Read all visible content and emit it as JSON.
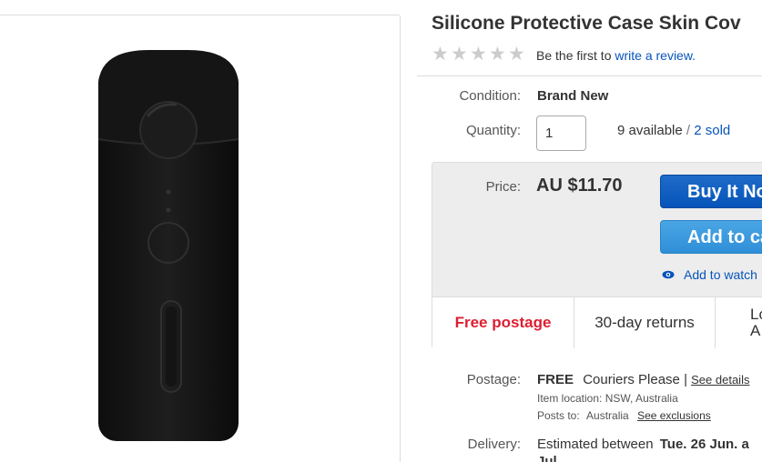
{
  "product": {
    "title": "Silicone Protective Case Skin Cov",
    "review_prefix": "Be the first to",
    "review_link": "write a review."
  },
  "condition": {
    "label": "Condition:",
    "value": "Brand New"
  },
  "quantity": {
    "label": "Quantity:",
    "value": "1",
    "available": "9 available",
    "separator": "/",
    "sold": "2 sold"
  },
  "price": {
    "label": "Price:",
    "value": "AU $11.70"
  },
  "buttons": {
    "buy_now": "Buy It No",
    "add_to_cart": "Add to ca",
    "watch": "Add to watch"
  },
  "highlights": {
    "free_postage": "Free postage",
    "returns": "30-day returns",
    "last_line1": "Lo",
    "last_line2": "A"
  },
  "postage": {
    "label": "Postage:",
    "free": "FREE",
    "service": "Couriers Please |",
    "see_details": "See details",
    "item_location_label": "Item location:",
    "item_location": "NSW, Australia",
    "posts_to_label": "Posts to:",
    "posts_to": "Australia",
    "see_exclusions": "See exclusions"
  },
  "delivery": {
    "label": "Delivery:",
    "prefix": "Estimated between",
    "dates": "Tue. 26 Jun. a",
    "next_line": "Jul"
  },
  "colors": {
    "link": "#0654ba",
    "buy_button": "#0654ba",
    "cart_button": "#3498db",
    "free_postage": "#dd1e31",
    "star_empty": "#cccccc"
  }
}
